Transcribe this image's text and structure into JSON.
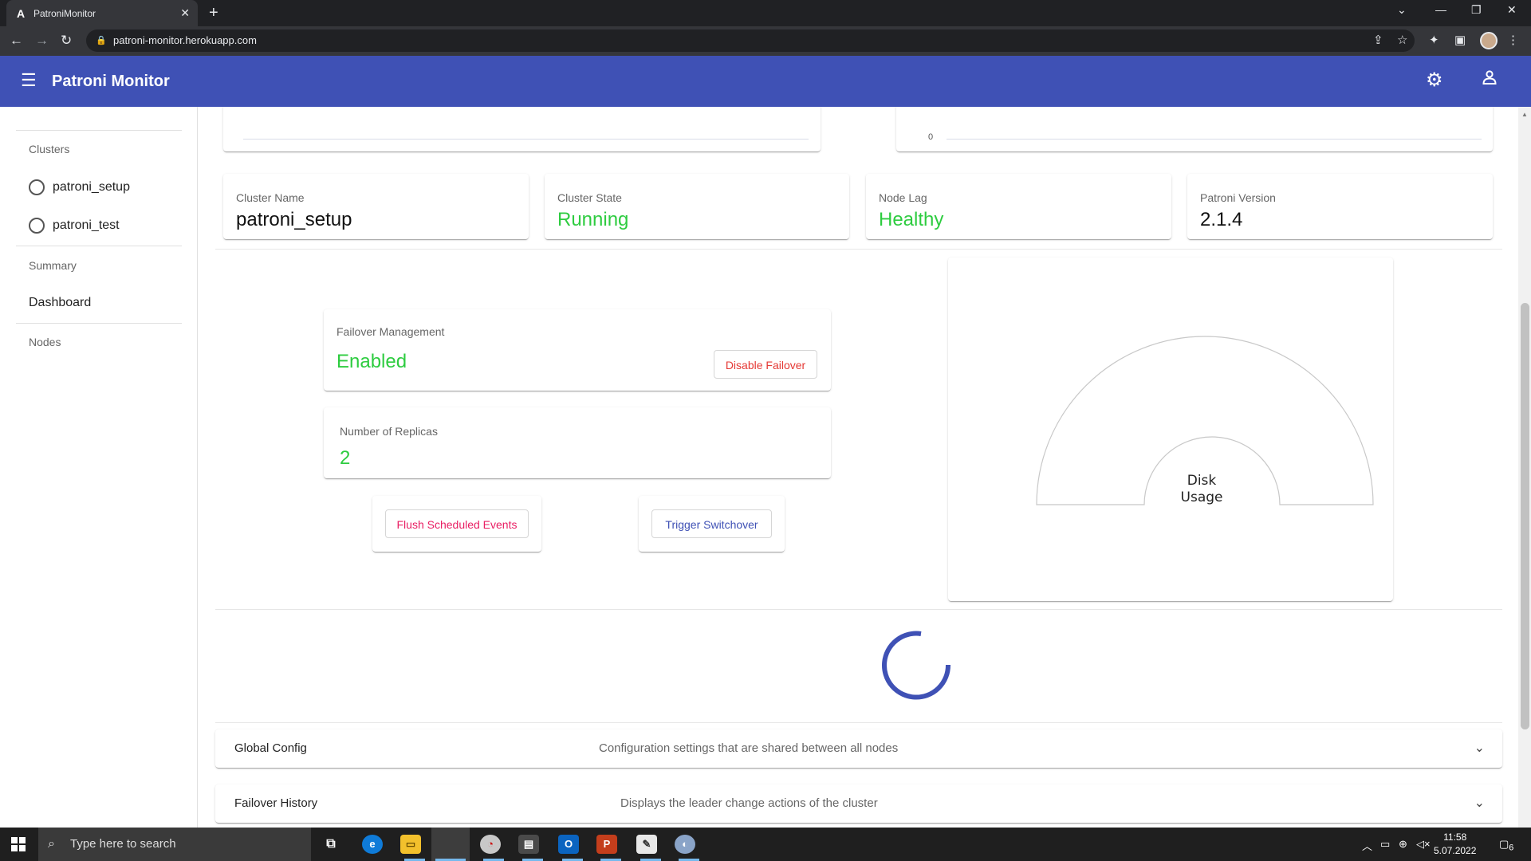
{
  "browser": {
    "tab_title": "PatroniMonitor",
    "tab_favicon": "A",
    "url": "patroni-monitor.herokuapp.com"
  },
  "app": {
    "title": "Patroni Monitor",
    "primary_color": "#3f51b5"
  },
  "sidebar": {
    "clusters_header": "Clusters",
    "clusters": [
      "patroni_setup",
      "patroni_test"
    ],
    "summary_header": "Summary",
    "dashboard_label": "Dashboard",
    "nodes_header": "Nodes"
  },
  "top_chart": {
    "axis_zero": "0"
  },
  "stats": [
    {
      "label": "Cluster Name",
      "value": "patroni_setup"
    },
    {
      "label": "Cluster State",
      "value": "Running"
    },
    {
      "label": "Node Lag",
      "value": "Healthy"
    },
    {
      "label": "Patroni Version",
      "value": "2.1.4"
    }
  ],
  "failover": {
    "label": "Failover Management",
    "status": "Enabled",
    "button": "Disable Failover"
  },
  "replicas": {
    "label": "Number of Replicas",
    "value": "2"
  },
  "actions": {
    "flush": "Flush Scheduled Events",
    "switchover": "Trigger Switchover"
  },
  "disk_gauge": {
    "label_line1": "Disk",
    "label_line2": "Usage"
  },
  "panels": [
    {
      "title": "Global Config",
      "description": "Configuration settings that are shared between all nodes"
    },
    {
      "title": "Failover History",
      "description": "Displays the leader change actions of the cluster"
    }
  ],
  "taskbar": {
    "search_placeholder": "Type here to search",
    "time": "11:58",
    "date": "5.07.2022",
    "notifications": "6"
  },
  "colors": {
    "success": "#2ecc40",
    "danger": "#e53935",
    "accent": "#e91e63"
  }
}
